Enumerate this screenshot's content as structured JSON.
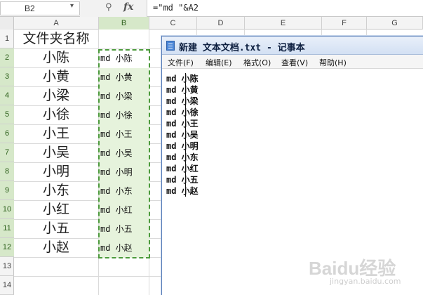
{
  "formula_bar": {
    "name_box": "B2",
    "formula": "=\"md \"&A2"
  },
  "columns": [
    "A",
    "B",
    "C",
    "D",
    "E",
    "F",
    "G"
  ],
  "rows": [
    "1",
    "2",
    "3",
    "4",
    "5",
    "6",
    "7",
    "8",
    "9",
    "10",
    "11",
    "12",
    "13",
    "14"
  ],
  "sheet": {
    "a_header": "文件夹名称",
    "a_values": [
      "小陈",
      "小黄",
      "小梁",
      "小徐",
      "小王",
      "小吴",
      "小明",
      "小东",
      "小红",
      "小五",
      "小赵"
    ],
    "b_values": [
      "md 小陈",
      "md 小黄",
      "md 小梁",
      "md 小徐",
      "md 小王",
      "md 小吴",
      "md 小明",
      "md 小东",
      "md 小红",
      "md 小五",
      "md 小赵"
    ]
  },
  "notepad": {
    "title": "新建 文本文档.txt - 记事本",
    "menu": [
      "文件(F)",
      "编辑(E)",
      "格式(O)",
      "查看(V)",
      "帮助(H)"
    ],
    "lines": [
      "md 小陈",
      "md 小黄",
      "md 小梁",
      "md 小徐",
      "md 小王",
      "md 小吴",
      "md 小明",
      "md 小东",
      "md 小红",
      "md 小五",
      "md 小赵"
    ]
  },
  "watermark": {
    "text": "Baidu经验",
    "sub": "jingyan.baidu.com"
  },
  "colors": {
    "selection_green": "#4c9a3c",
    "selection_fill": "#e6f3dc",
    "header_selected": "#d6e8c9"
  }
}
